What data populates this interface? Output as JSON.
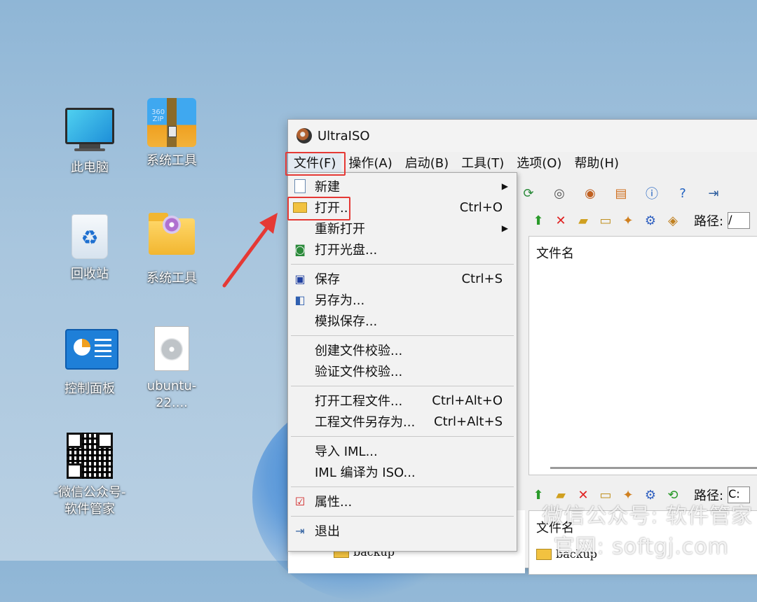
{
  "desktop": {
    "icons": [
      {
        "label": "此电脑"
      },
      {
        "label": "系统工具",
        "badge": "360\nZIP"
      },
      {
        "label": "回收站"
      },
      {
        "label": "系统工具"
      },
      {
        "label": "控制面板"
      },
      {
        "label": "ubuntu-22...."
      },
      {
        "label": "-微信公众号-\n软件管家"
      }
    ]
  },
  "window": {
    "title": "UltraISO",
    "menu": [
      "文件(F)",
      "操作(A)",
      "启动(B)",
      "工具(T)",
      "选项(O)",
      "帮助(H)"
    ],
    "path_label": "路径:",
    "path_value": "/",
    "path_label_2": "路径:",
    "path_value_2": "C:",
    "column_header": "文件名",
    "column_header_2": "文件名",
    "tree_item": "backup",
    "list_item": "backup"
  },
  "file_menu": {
    "items": [
      {
        "label": "新建",
        "shortcut": "",
        "submenu": true,
        "icon": "new-file-icon"
      },
      {
        "label": "打开..",
        "shortcut": "Ctrl+O",
        "icon": "open-folder-icon"
      },
      {
        "label": "重新打开",
        "shortcut": "",
        "submenu": true
      },
      {
        "label": "打开光盘...",
        "shortcut": "",
        "icon": "disc-drive-icon"
      },
      {
        "label": "保存",
        "shortcut": "Ctrl+S",
        "icon": "save-icon"
      },
      {
        "label": "另存为...",
        "shortcut": "",
        "icon": "save-as-icon"
      },
      {
        "label": "模拟保存...",
        "shortcut": ""
      },
      {
        "label": "创建文件校验...",
        "shortcut": ""
      },
      {
        "label": "验证文件校验...",
        "shortcut": ""
      },
      {
        "label": "打开工程文件...",
        "shortcut": "Ctrl+Alt+O"
      },
      {
        "label": "工程文件另存为...",
        "shortcut": "Ctrl+Alt+S"
      },
      {
        "label": "导入 IML...",
        "shortcut": ""
      },
      {
        "label": "IML 编译为 ISO...",
        "shortcut": ""
      },
      {
        "label": "属性...",
        "shortcut": "",
        "icon": "properties-icon"
      },
      {
        "label": "退出",
        "shortcut": "",
        "icon": "exit-icon"
      }
    ]
  },
  "watermark": {
    "line1": "微信公众号: 软件管家",
    "line2": "官网: softgj.com"
  },
  "colors": {
    "highlight": "#e53935",
    "arrow": "#e53935"
  }
}
